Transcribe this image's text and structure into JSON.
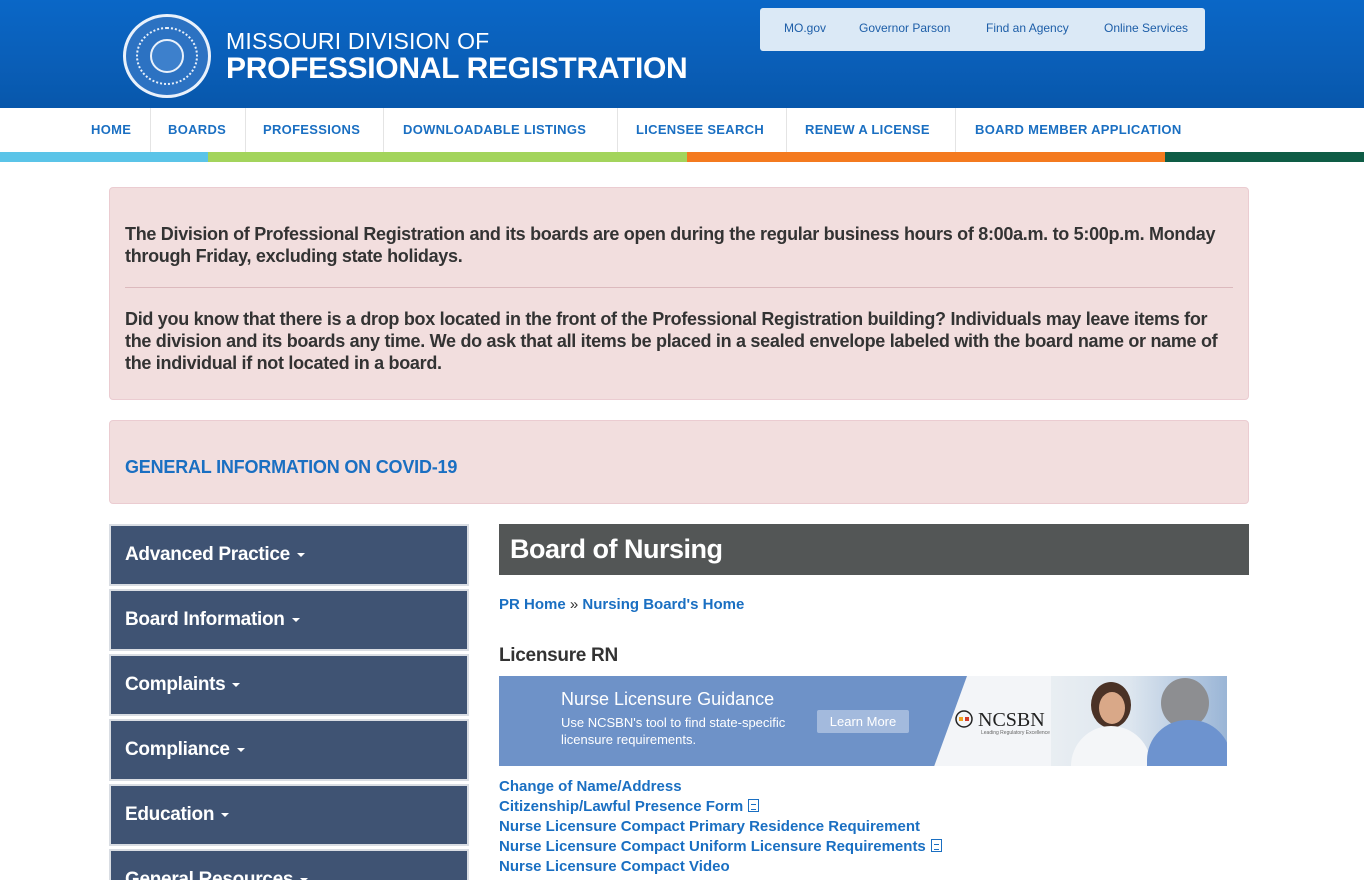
{
  "header": {
    "brand_line1": "MISSOURI DIVISION OF",
    "brand_line2": "PROFESSIONAL REGISTRATION",
    "utility_links": [
      "MO.gov",
      "Governor Parson",
      "Find an Agency",
      "Online Services"
    ]
  },
  "nav": {
    "items": [
      "HOME",
      "BOARDS",
      "PROFESSIONS",
      "DOWNLOADABLE LISTINGS",
      "LICENSEE SEARCH",
      "RENEW A LICENSE",
      "BOARD MEMBER APPLICATION"
    ]
  },
  "colors": {
    "header_blue": "#0a5eb7",
    "bar_light_blue": "#5bc4e8",
    "bar_green": "#a3d45c",
    "bar_orange": "#f47a1f",
    "bar_dark_green": "#0e5c45",
    "link_blue": "#1a6fc2",
    "sidebar_navy": "#3f5373",
    "alert_bg": "#f2dede"
  },
  "notice": {
    "paragraph1": "The Division of Professional Registration and its boards are open during the regular business hours of 8:00a.m. to 5:00p.m. Monday through Friday, excluding state holidays.",
    "paragraph2": "Did you know that there is a drop box located in the front of the Professional Registration building? Individuals may leave items for the division and its boards any time. We do ask that all items be placed in a sealed envelope labeled with the board name or name of the individual if not located in a board."
  },
  "covid": {
    "link": "GENERAL INFORMATION ON COVID-19"
  },
  "sidebar": {
    "items": [
      "Advanced Practice",
      "Board Information",
      "Complaints",
      "Compliance",
      "Education",
      "General Resources"
    ]
  },
  "content": {
    "board_title": "Board of Nursing",
    "breadcrumb": [
      "PR Home",
      "Nursing Board's Home"
    ],
    "breadcrumb_sep": "»",
    "section_heading": "Licensure RN",
    "banner": {
      "title": "Nurse Licensure Guidance",
      "subtitle": "Use NCSBN's tool to find state-specific licensure requirements.",
      "button": "Learn More",
      "logo_text": "NCSBN",
      "logo_tagline": "Leading Regulatory Excellence"
    },
    "links": [
      {
        "text": "Change of Name/Address",
        "pdf": false
      },
      {
        "text": "Citizenship/Lawful Presence Form",
        "pdf": true
      },
      {
        "text": "Nurse Licensure Compact Primary Residence Requirement",
        "pdf": false
      },
      {
        "text": "Nurse Licensure Compact Uniform Licensure Requirements",
        "pdf": true
      },
      {
        "text": "Nurse Licensure Compact Video",
        "pdf": false
      }
    ]
  }
}
